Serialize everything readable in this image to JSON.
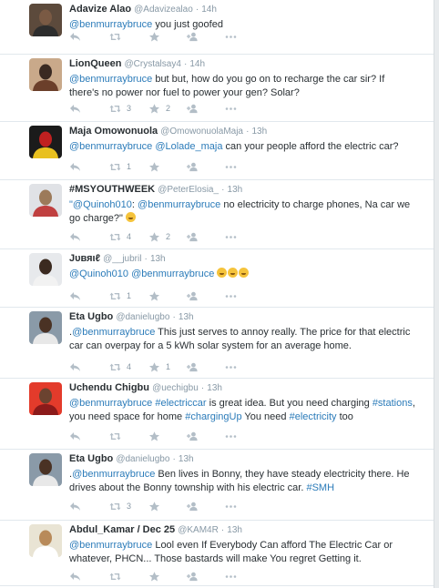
{
  "tweets": [
    {
      "fullname": "Adavize Alao",
      "username": "@Adavizealao",
      "time": "14h",
      "segments": [
        {
          "t": "@benmurraybruce",
          "m": true
        },
        {
          "t": " you just goofed",
          "m": false
        }
      ],
      "retweets": "",
      "favorites": ""
    },
    {
      "fullname": "LionQueen",
      "username": "@Crystalsay4",
      "time": "14h",
      "segments": [
        {
          "t": "@benmurraybruce",
          "m": true
        },
        {
          "t": " but but, how do you go on to recharge the car sir? If there's no power nor fuel to power your gen? Solar?",
          "m": false
        }
      ],
      "retweets": "3",
      "favorites": "2"
    },
    {
      "fullname": "Maja Omowonuola",
      "username": "@OmowonuolaMaja",
      "time": "13h",
      "segments": [
        {
          "t": "@benmurraybruce",
          "m": true
        },
        {
          "t": " ",
          "m": false
        },
        {
          "t": "@Lolade_maja",
          "m": true
        },
        {
          "t": " can your people afford the electric car?",
          "m": false
        }
      ],
      "retweets": "1",
      "favorites": ""
    },
    {
      "fullname": "#MSYOUTHWEEK",
      "username": "@PeterElosia_",
      "time": "13h",
      "segments": [
        {
          "t": "\"",
          "m": true
        },
        {
          "t": "@Quinoh010",
          "m": true
        },
        {
          "t": ": ",
          "m": false
        },
        {
          "t": "@benmurraybruce",
          "m": true
        },
        {
          "t": " no electricity to charge phones, Na car we go charge?\" ",
          "m": false
        }
      ],
      "emoji_count": 1,
      "retweets": "4",
      "favorites": "2"
    },
    {
      "fullname": "Jυвяιℓ",
      "username": "@__jubril",
      "time": "13h",
      "segments": [
        {
          "t": "@Quinoh010",
          "m": true
        },
        {
          "t": " ",
          "m": false
        },
        {
          "t": "@benmurraybruce",
          "m": true
        },
        {
          "t": " ",
          "m": false
        }
      ],
      "emoji_count": 3,
      "retweets": "1",
      "favorites": ""
    },
    {
      "fullname": "Eta Ugbo",
      "username": "@danielugbo",
      "time": "13h",
      "segments": [
        {
          "t": ".",
          "m": false
        },
        {
          "t": "@benmurraybruce",
          "m": true
        },
        {
          "t": " This just serves to annoy really. The price for that electric car can overpay for a 5 kWh solar system for an average home.",
          "m": false
        }
      ],
      "retweets": "4",
      "favorites": "1"
    },
    {
      "fullname": "Uchendu Chigbu",
      "username": "@uechigbu",
      "time": "13h",
      "segments": [
        {
          "t": "@benmurraybruce",
          "m": true
        },
        {
          "t": " ",
          "m": false
        },
        {
          "t": "#electriccar",
          "m": true
        },
        {
          "t": " is great idea. But you need charging ",
          "m": false
        },
        {
          "t": "#stations",
          "m": true
        },
        {
          "t": ", you need space for home ",
          "m": false
        },
        {
          "t": "#chargingUp",
          "m": true
        },
        {
          "t": " You need ",
          "m": false
        },
        {
          "t": "#electricity",
          "m": true
        },
        {
          "t": " too",
          "m": false
        }
      ],
      "retweets": "",
      "favorites": ""
    },
    {
      "fullname": "Eta Ugbo",
      "username": "@danielugbo",
      "time": "13h",
      "segments": [
        {
          "t": ".",
          "m": false
        },
        {
          "t": "@benmurraybruce",
          "m": true
        },
        {
          "t": " Ben lives in Bonny, they have steady electricity there. He drives about the Bonny township with his electric car. ",
          "m": false
        },
        {
          "t": "#SMH",
          "m": true
        }
      ],
      "retweets": "3",
      "favorites": ""
    },
    {
      "fullname": "Abdul_Kamar / Dec 25",
      "username": "@KAM4R",
      "time": "13h",
      "segments": [
        {
          "t": "@benmurraybruce",
          "m": true
        },
        {
          "t": " Lool even If Everybody Can afford The Electric Car or whatever, PHCN... Those bastards will make You regret Getting it.",
          "m": false
        }
      ],
      "retweets": "",
      "favorites": ""
    }
  ],
  "separator": "·",
  "icons": {
    "reply": "reply-icon",
    "retweet": "retweet-icon",
    "favorite": "star-icon",
    "follow": "follow-icon",
    "more": "more-icon"
  },
  "colors": {
    "link": "#2b7bb9",
    "muted": "#8899a6",
    "text": "#292f33",
    "divider": "#e1e8ed"
  }
}
